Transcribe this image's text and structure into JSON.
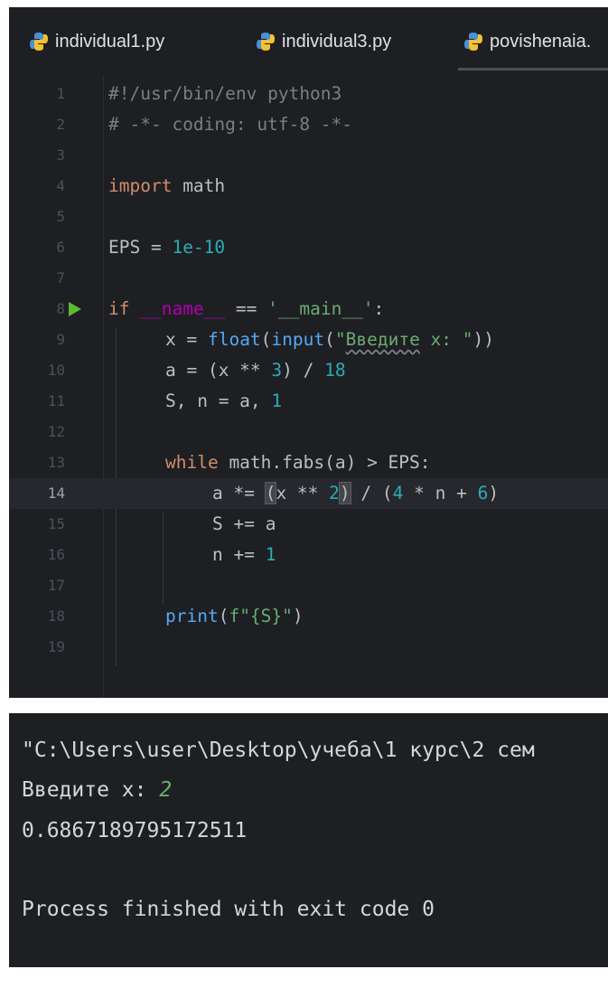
{
  "tabs": [
    {
      "label": "individual1.py",
      "active": false
    },
    {
      "label": "individual3.py",
      "active": false
    },
    {
      "label": "povishenaia.",
      "active": true
    }
  ],
  "editor": {
    "current_line": "14",
    "line_numbers": [
      "1",
      "2",
      "3",
      "4",
      "5",
      "6",
      "7",
      "8",
      "9",
      "10",
      "11",
      "12",
      "13",
      "14",
      "15",
      "16",
      "17",
      "18",
      "19"
    ],
    "lines": {
      "l1": "#!/usr/bin/env python3",
      "l2": "# -*- coding: utf-8 -*-",
      "l4_kw": "import",
      "l4_rest": " math",
      "l6_a": "EPS = ",
      "l6_num": "1e-10",
      "l8_kw": "if",
      "l8_sp": " ",
      "l8_dun": "__name__",
      "l8_op": " == ",
      "l8_str": "'__main__'",
      "l8_end": ":",
      "l9_a": "x = ",
      "l9_fn1": "float",
      "l9_p1": "(",
      "l9_fn2": "input",
      "l9_p2": "(",
      "l9_q": "\"",
      "l9_sq": "Введите",
      "l9_s2": " x: \"",
      "l9_end": "))",
      "l10_a": "a = (x ** ",
      "l10_n1": "3",
      "l10_b": ") / ",
      "l10_n2": "18",
      "l11_a": "S, n = a, ",
      "l11_n": "1",
      "l13_kw": "while",
      "l13_rest": " math.fabs(a) > EPS:",
      "l14_a": "a *= ",
      "l14_b1": "(",
      "l14_c": "x ** ",
      "l14_n1": "2",
      "l14_b2": ")",
      "l14_d": " / (",
      "l14_n2": "4",
      "l14_e": " * n + ",
      "l14_n3": "6",
      "l14_f": ")",
      "l15": "S += a",
      "l16_a": "n += ",
      "l16_n": "1",
      "l18_fn": "print",
      "l18_p": "(",
      "l18_str": "f\"{S}\"",
      "l18_end": ")"
    }
  },
  "console": {
    "path": "\"C:\\Users\\user\\Desktop\\учеба\\1 курс\\2 сем",
    "prompt": "Введите x: ",
    "user_input": "2",
    "result": "0.6867189795172511",
    "exit": "Process finished with exit code 0"
  },
  "colors": {
    "background": "#1e1f22",
    "keyword": "#cf8e6d",
    "number": "#2aacb8",
    "string": "#6aab73",
    "function": "#56a8f5",
    "dunder": "#b200b2",
    "run_icon": "#5fb832"
  },
  "icons": [
    "python-file-icon",
    "run-gutter-icon"
  ]
}
